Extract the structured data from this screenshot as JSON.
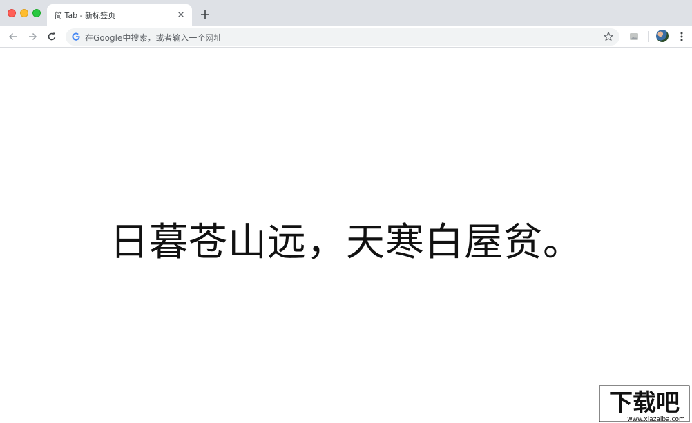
{
  "window": {
    "traffic_lights": [
      "close",
      "minimize",
      "zoom"
    ]
  },
  "tab": {
    "title": "简 Tab - 新标签页"
  },
  "toolbar": {
    "omnibox_placeholder": "在Google中搜索，或者输入一个网址"
  },
  "page": {
    "poem": "日暮苍山远，天寒白屋贫。"
  },
  "watermark": {
    "brand": "下载吧",
    "url": "www.xiazaiba.com"
  },
  "colors": {
    "tabstrip_bg": "#dee1e6",
    "omnibox_bg": "#f1f3f4",
    "text": "#111111"
  }
}
